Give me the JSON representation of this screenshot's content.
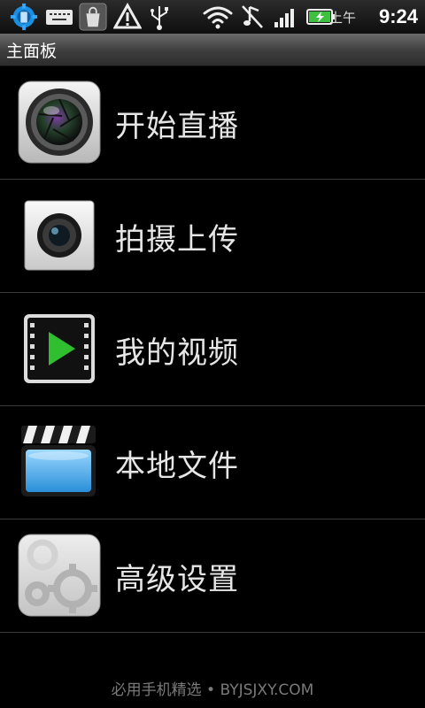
{
  "status_bar": {
    "icons": [
      "settings-sync-icon",
      "keyboard-icon",
      "bag-icon",
      "warning-icon",
      "usb-icon",
      "wifi-icon",
      "music-off-icon",
      "signal-icon",
      "battery-charging-icon"
    ],
    "ampm": "上午",
    "time": "9:24"
  },
  "title_bar": {
    "title": "主面板"
  },
  "menu": {
    "items": [
      {
        "label": "开始直播",
        "icon": "camera-lens-icon"
      },
      {
        "label": "拍摄上传",
        "icon": "camera-icon"
      },
      {
        "label": "我的视频",
        "icon": "video-play-icon"
      },
      {
        "label": "本地文件",
        "icon": "clapperboard-icon"
      },
      {
        "label": "高级设置",
        "icon": "gears-icon"
      }
    ]
  },
  "footer": {
    "text": "必用手机精选 • BYJSJXY.COM"
  }
}
